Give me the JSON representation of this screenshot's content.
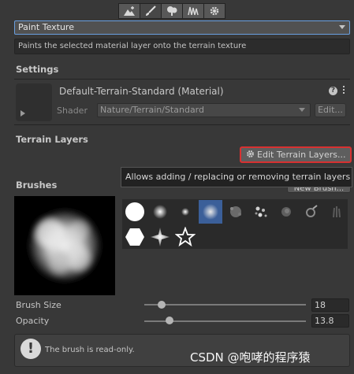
{
  "toolbar": {
    "tools": [
      "raise-lower-terrain-icon",
      "paint-brush-icon",
      "paint-trees-icon",
      "paint-details-icon",
      "gear-icon"
    ],
    "active_index": 1
  },
  "tool_dropdown": {
    "value": "Paint Texture"
  },
  "tool_description": "Paints the selected material layer onto the terrain texture",
  "settings": {
    "heading": "Settings",
    "material_name": "Default-Terrain-Standard (Material)",
    "shader_label": "Shader",
    "shader_value": "Nature/Terrain/Standard",
    "edit_button": "Edit...",
    "help_icon": "?"
  },
  "terrain_layers": {
    "heading": "Terrain Layers",
    "edit_button": "Edit Terrain Layers...",
    "tooltip": "Allows adding / replacing or removing terrain layers"
  },
  "brushes": {
    "heading": "Brushes",
    "new_brush_button": "New Brush...",
    "items": [
      "circle-brush",
      "soft-dot-brush",
      "small-dot-brush",
      "cloud-brush",
      "splatter-brush",
      "scatter-brush",
      "smudge-brush",
      "burst-brush",
      "grass-brush",
      "hexagon-brush",
      "star-burst-brush",
      "star-outline-brush"
    ],
    "selected_index": 3
  },
  "brush_size": {
    "label": "Brush Size",
    "value": "18",
    "fraction": 0.09
  },
  "opacity": {
    "label": "Opacity",
    "value": "13.8",
    "fraction": 0.14
  },
  "info": {
    "icon": "!",
    "text": "The brush is read-only."
  },
  "watermark": "CSDN @咆哮的程序猿"
}
